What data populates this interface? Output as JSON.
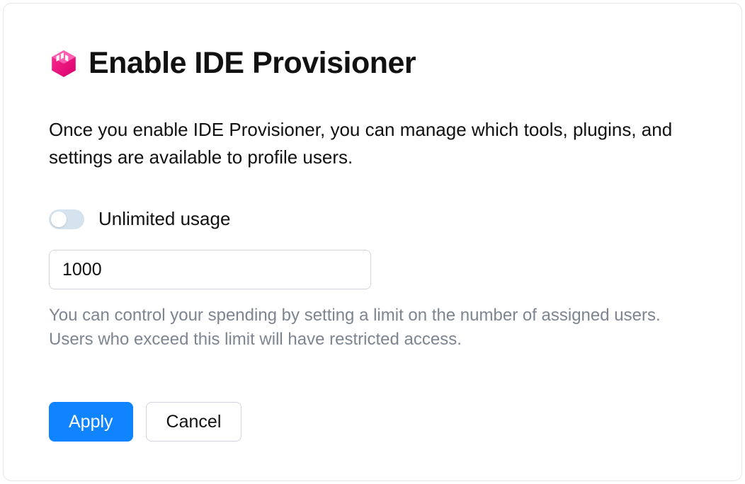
{
  "header": {
    "icon": "toolbox-icon",
    "title": "Enable IDE Provisioner"
  },
  "description": "Once you enable IDE Provisioner, you can manage which tools, plugins, and settings are available to profile users.",
  "toggle": {
    "label": "Unlimited usage",
    "state": "off"
  },
  "limit_input": {
    "value": "1000"
  },
  "help_text": "You can control your spending by setting a limit on the number of assigned users. Users who exceed this limit will have restricted access.",
  "buttons": {
    "apply": "Apply",
    "cancel": "Cancel"
  },
  "colors": {
    "primary": "#1083ff",
    "icon_accent": "#e8238c",
    "toggle_bg": "#d5e3ee",
    "border": "#d1d5db",
    "help_text": "#7d8590"
  }
}
